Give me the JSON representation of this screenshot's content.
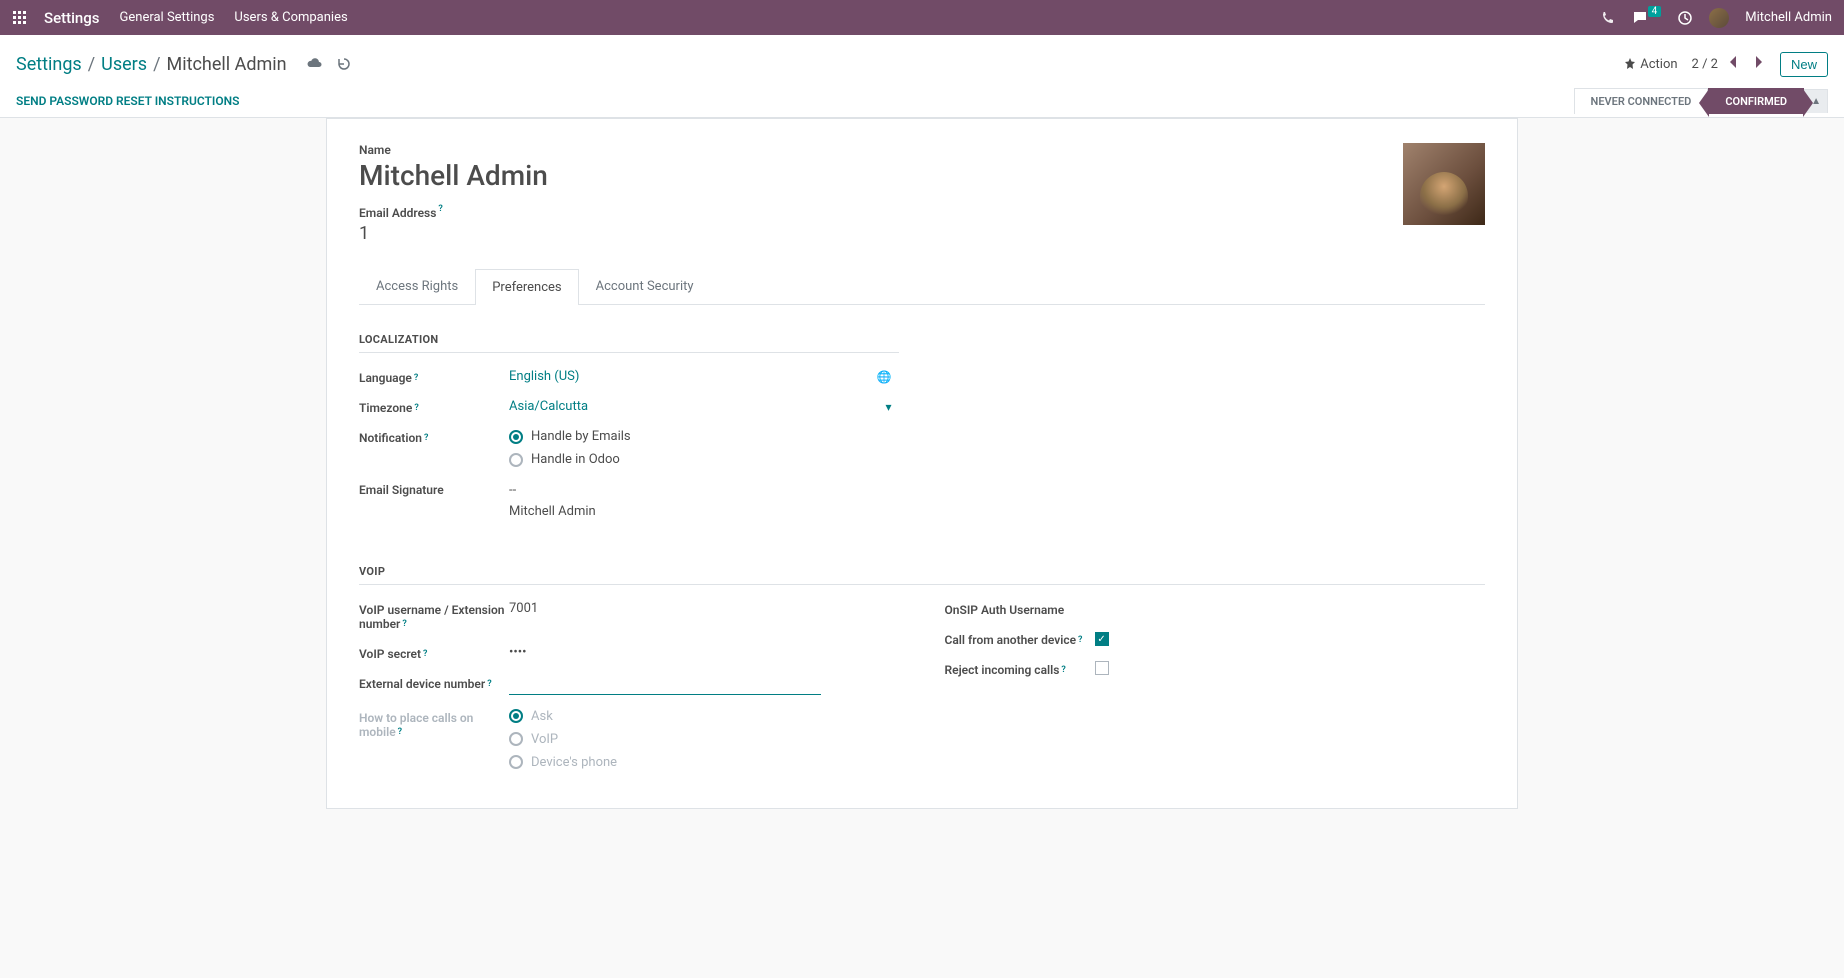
{
  "navbar": {
    "app_title": "Settings",
    "menus": [
      "General Settings",
      "Users & Companies"
    ],
    "messages_badge": "4",
    "user_name": "Mitchell Admin"
  },
  "breadcrumb": {
    "root": "Settings",
    "mid": "Users",
    "current": "Mitchell Admin"
  },
  "controls": {
    "action_label": "Action",
    "pager": "2 / 2",
    "new_label": "New",
    "reset_link": "SEND PASSWORD RESET INSTRUCTIONS",
    "status_inactive": "NEVER CONNECTED",
    "status_active": "CONFIRMED"
  },
  "form": {
    "name_label": "Name",
    "name_value": "Mitchell Admin",
    "email_label": "Email Address",
    "email_value": "1",
    "tabs": [
      "Access Rights",
      "Preferences",
      "Account Security"
    ],
    "active_tab_index": 1
  },
  "localization": {
    "title": "LOCALIZATION",
    "language_label": "Language",
    "language_value": "English (US)",
    "timezone_label": "Timezone",
    "timezone_value": "Asia/Calcutta",
    "notification_label": "Notification",
    "notification_options": [
      "Handle by Emails",
      "Handle in Odoo"
    ],
    "notification_selected": 0,
    "signature_label": "Email Signature",
    "signature_line1": "--",
    "signature_line2": "Mitchell Admin"
  },
  "voip": {
    "title": "VOIP",
    "username_label": "VoIP username / Extension number",
    "username_value": "7001",
    "secret_label": "VoIP secret",
    "secret_value": "••••",
    "external_label": "External device number",
    "external_value": "",
    "mobile_label": "How to place calls on mobile",
    "mobile_options": [
      "Ask",
      "VoIP",
      "Device's phone"
    ],
    "mobile_selected": 0,
    "onsip_label": "OnSIP Auth Username",
    "call_other_label": "Call from another device",
    "call_other_checked": true,
    "reject_label": "Reject incoming calls",
    "reject_checked": false
  }
}
